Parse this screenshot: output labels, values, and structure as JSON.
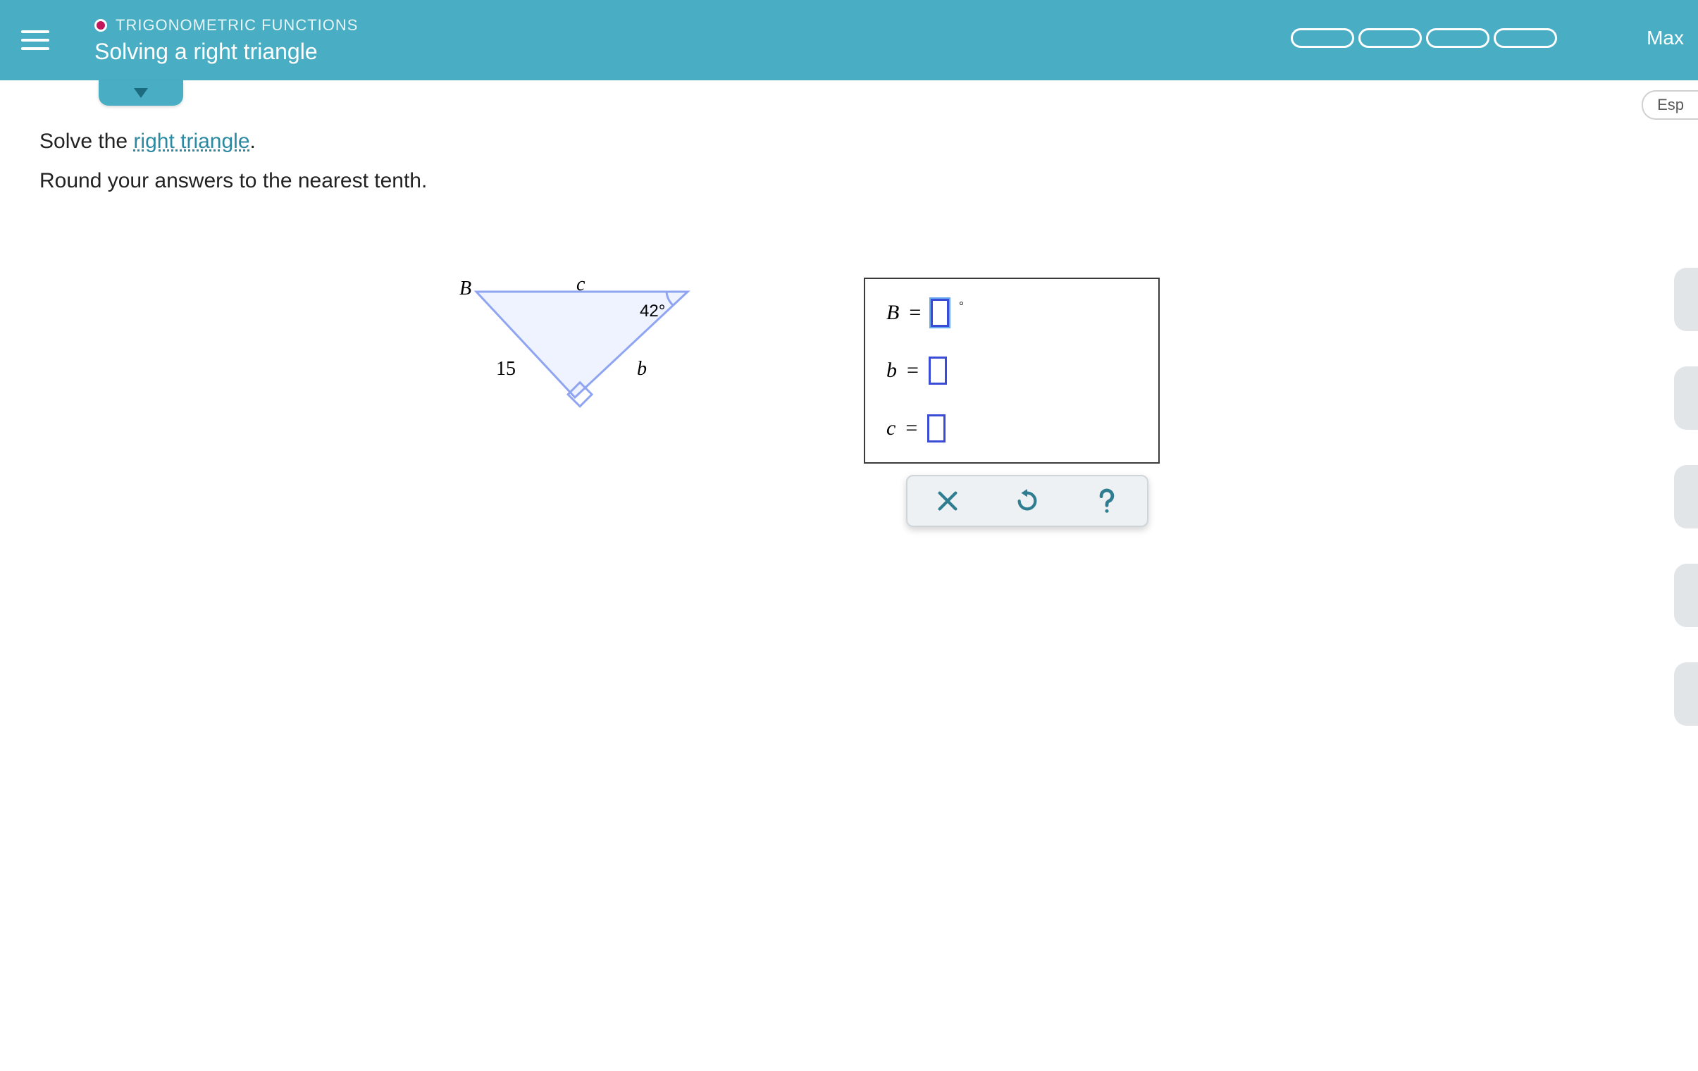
{
  "header": {
    "category": "TRIGONOMETRIC FUNCTIONS",
    "subtitle": "Solving a right triangle",
    "user": "Max",
    "lang_button": "Esp"
  },
  "prompt": {
    "prefix": "Solve the ",
    "link_text": "right triangle",
    "suffix": "."
  },
  "instruction": "Round your answers to the nearest tenth.",
  "triangle": {
    "vertex_B": "B",
    "side_c": "c",
    "angle": "42°",
    "side_a": "15",
    "side_b": "b"
  },
  "answers": {
    "B_label": "B",
    "b_label": "b",
    "c_label": "c",
    "equals": "=",
    "degree": "°"
  }
}
